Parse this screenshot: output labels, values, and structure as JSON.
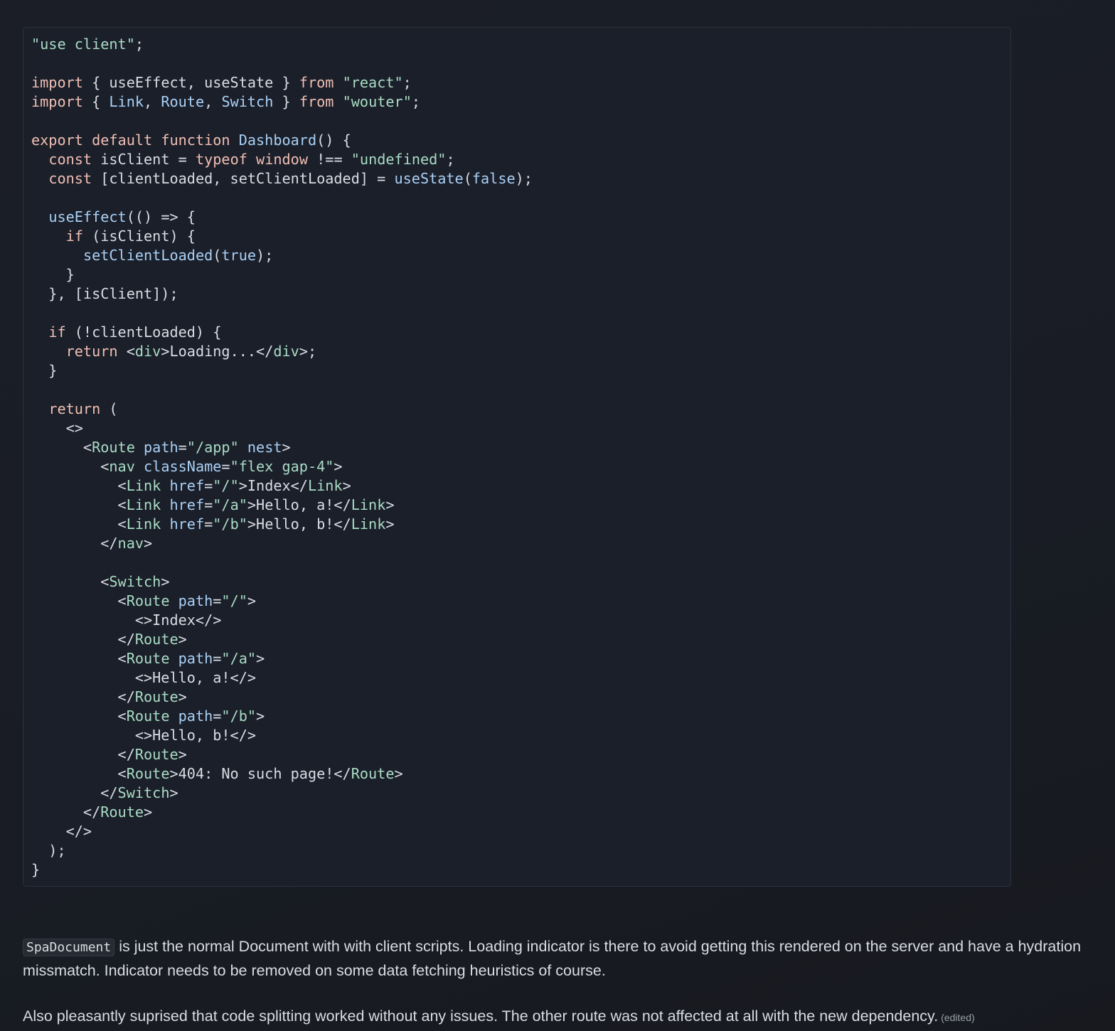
{
  "code_block": {
    "lines": [
      [
        {
          "t": "\"use client\"",
          "c": "string"
        },
        {
          "t": ";",
          "c": "punct"
        }
      ],
      [],
      [
        {
          "t": "import",
          "c": "keyword"
        },
        {
          "t": " { useEffect, useState } ",
          "c": "plain"
        },
        {
          "t": "from",
          "c": "keyword"
        },
        {
          "t": " ",
          "c": "plain"
        },
        {
          "t": "\"react\"",
          "c": "string"
        },
        {
          "t": ";",
          "c": "punct"
        }
      ],
      [
        {
          "t": "import",
          "c": "keyword"
        },
        {
          "t": " { ",
          "c": "plain"
        },
        {
          "t": "Link",
          "c": "func"
        },
        {
          "t": ", ",
          "c": "plain"
        },
        {
          "t": "Route",
          "c": "func"
        },
        {
          "t": ", ",
          "c": "plain"
        },
        {
          "t": "Switch",
          "c": "func"
        },
        {
          "t": " } ",
          "c": "plain"
        },
        {
          "t": "from",
          "c": "keyword"
        },
        {
          "t": " ",
          "c": "plain"
        },
        {
          "t": "\"wouter\"",
          "c": "string"
        },
        {
          "t": ";",
          "c": "punct"
        }
      ],
      [],
      [
        {
          "t": "export",
          "c": "keyword"
        },
        {
          "t": " ",
          "c": "plain"
        },
        {
          "t": "default",
          "c": "keyword"
        },
        {
          "t": " ",
          "c": "plain"
        },
        {
          "t": "function",
          "c": "keyword"
        },
        {
          "t": " ",
          "c": "plain"
        },
        {
          "t": "Dashboard",
          "c": "func"
        },
        {
          "t": "() {",
          "c": "plain"
        }
      ],
      [
        {
          "t": "  ",
          "c": "plain"
        },
        {
          "t": "const",
          "c": "keyword"
        },
        {
          "t": " isClient = ",
          "c": "plain"
        },
        {
          "t": "typeof",
          "c": "keyword"
        },
        {
          "t": " ",
          "c": "plain"
        },
        {
          "t": "window",
          "c": "keyword"
        },
        {
          "t": " !== ",
          "c": "plain"
        },
        {
          "t": "\"undefined\"",
          "c": "string"
        },
        {
          "t": ";",
          "c": "punct"
        }
      ],
      [
        {
          "t": "  ",
          "c": "plain"
        },
        {
          "t": "const",
          "c": "keyword"
        },
        {
          "t": " [clientLoaded, setClientLoaded] = ",
          "c": "plain"
        },
        {
          "t": "useState",
          "c": "func"
        },
        {
          "t": "(",
          "c": "plain"
        },
        {
          "t": "false",
          "c": "func"
        },
        {
          "t": ");",
          "c": "plain"
        }
      ],
      [],
      [
        {
          "t": "  ",
          "c": "plain"
        },
        {
          "t": "useEffect",
          "c": "func"
        },
        {
          "t": "(() => {",
          "c": "plain"
        }
      ],
      [
        {
          "t": "    ",
          "c": "plain"
        },
        {
          "t": "if",
          "c": "keyword"
        },
        {
          "t": " (isClient) {",
          "c": "plain"
        }
      ],
      [
        {
          "t": "      ",
          "c": "plain"
        },
        {
          "t": "setClientLoaded",
          "c": "func"
        },
        {
          "t": "(",
          "c": "plain"
        },
        {
          "t": "true",
          "c": "func"
        },
        {
          "t": ");",
          "c": "plain"
        }
      ],
      [
        {
          "t": "    }",
          "c": "plain"
        }
      ],
      [
        {
          "t": "  }, [isClient]);",
          "c": "plain"
        }
      ],
      [],
      [
        {
          "t": "  ",
          "c": "plain"
        },
        {
          "t": "if",
          "c": "keyword"
        },
        {
          "t": " (!clientLoaded) {",
          "c": "plain"
        }
      ],
      [
        {
          "t": "    ",
          "c": "plain"
        },
        {
          "t": "return",
          "c": "keyword"
        },
        {
          "t": " <",
          "c": "plain"
        },
        {
          "t": "div",
          "c": "tag"
        },
        {
          "t": ">Loading...</",
          "c": "plain"
        },
        {
          "t": "div",
          "c": "tag"
        },
        {
          "t": ">;",
          "c": "plain"
        }
      ],
      [
        {
          "t": "  }",
          "c": "plain"
        }
      ],
      [],
      [
        {
          "t": "  ",
          "c": "plain"
        },
        {
          "t": "return",
          "c": "keyword"
        },
        {
          "t": " (",
          "c": "plain"
        }
      ],
      [
        {
          "t": "    <>",
          "c": "plain"
        }
      ],
      [
        {
          "t": "      <",
          "c": "plain"
        },
        {
          "t": "Route",
          "c": "tag"
        },
        {
          "t": " ",
          "c": "plain"
        },
        {
          "t": "path",
          "c": "func"
        },
        {
          "t": "=",
          "c": "plain"
        },
        {
          "t": "\"/app\"",
          "c": "string"
        },
        {
          "t": " ",
          "c": "plain"
        },
        {
          "t": "nest",
          "c": "func"
        },
        {
          "t": ">",
          "c": "plain"
        }
      ],
      [
        {
          "t": "        <",
          "c": "plain"
        },
        {
          "t": "nav",
          "c": "tag"
        },
        {
          "t": " ",
          "c": "plain"
        },
        {
          "t": "className",
          "c": "func"
        },
        {
          "t": "=",
          "c": "plain"
        },
        {
          "t": "\"flex gap-4\"",
          "c": "string"
        },
        {
          "t": ">",
          "c": "plain"
        }
      ],
      [
        {
          "t": "          <",
          "c": "plain"
        },
        {
          "t": "Link",
          "c": "tag"
        },
        {
          "t": " ",
          "c": "plain"
        },
        {
          "t": "href",
          "c": "func"
        },
        {
          "t": "=",
          "c": "plain"
        },
        {
          "t": "\"/\"",
          "c": "string"
        },
        {
          "t": ">Index</",
          "c": "plain"
        },
        {
          "t": "Link",
          "c": "tag"
        },
        {
          "t": ">",
          "c": "plain"
        }
      ],
      [
        {
          "t": "          <",
          "c": "plain"
        },
        {
          "t": "Link",
          "c": "tag"
        },
        {
          "t": " ",
          "c": "plain"
        },
        {
          "t": "href",
          "c": "func"
        },
        {
          "t": "=",
          "c": "plain"
        },
        {
          "t": "\"/a\"",
          "c": "string"
        },
        {
          "t": ">Hello, a!</",
          "c": "plain"
        },
        {
          "t": "Link",
          "c": "tag"
        },
        {
          "t": ">",
          "c": "plain"
        }
      ],
      [
        {
          "t": "          <",
          "c": "plain"
        },
        {
          "t": "Link",
          "c": "tag"
        },
        {
          "t": " ",
          "c": "plain"
        },
        {
          "t": "href",
          "c": "func"
        },
        {
          "t": "=",
          "c": "plain"
        },
        {
          "t": "\"/b\"",
          "c": "string"
        },
        {
          "t": ">Hello, b!</",
          "c": "plain"
        },
        {
          "t": "Link",
          "c": "tag"
        },
        {
          "t": ">",
          "c": "plain"
        }
      ],
      [
        {
          "t": "        </",
          "c": "plain"
        },
        {
          "t": "nav",
          "c": "tag"
        },
        {
          "t": ">",
          "c": "plain"
        }
      ],
      [],
      [
        {
          "t": "        <",
          "c": "plain"
        },
        {
          "t": "Switch",
          "c": "tag"
        },
        {
          "t": ">",
          "c": "plain"
        }
      ],
      [
        {
          "t": "          <",
          "c": "plain"
        },
        {
          "t": "Route",
          "c": "tag"
        },
        {
          "t": " ",
          "c": "plain"
        },
        {
          "t": "path",
          "c": "func"
        },
        {
          "t": "=",
          "c": "plain"
        },
        {
          "t": "\"/\"",
          "c": "string"
        },
        {
          "t": ">",
          "c": "plain"
        }
      ],
      [
        {
          "t": "            <>Index</>",
          "c": "plain"
        }
      ],
      [
        {
          "t": "          </",
          "c": "plain"
        },
        {
          "t": "Route",
          "c": "tag"
        },
        {
          "t": ">",
          "c": "plain"
        }
      ],
      [
        {
          "t": "          <",
          "c": "plain"
        },
        {
          "t": "Route",
          "c": "tag"
        },
        {
          "t": " ",
          "c": "plain"
        },
        {
          "t": "path",
          "c": "func"
        },
        {
          "t": "=",
          "c": "plain"
        },
        {
          "t": "\"/a\"",
          "c": "string"
        },
        {
          "t": ">",
          "c": "plain"
        }
      ],
      [
        {
          "t": "            <>Hello, a!</>",
          "c": "plain"
        }
      ],
      [
        {
          "t": "          </",
          "c": "plain"
        },
        {
          "t": "Route",
          "c": "tag"
        },
        {
          "t": ">",
          "c": "plain"
        }
      ],
      [
        {
          "t": "          <",
          "c": "plain"
        },
        {
          "t": "Route",
          "c": "tag"
        },
        {
          "t": " ",
          "c": "plain"
        },
        {
          "t": "path",
          "c": "func"
        },
        {
          "t": "=",
          "c": "plain"
        },
        {
          "t": "\"/b\"",
          "c": "string"
        },
        {
          "t": ">",
          "c": "plain"
        }
      ],
      [
        {
          "t": "            <>Hello, b!</>",
          "c": "plain"
        }
      ],
      [
        {
          "t": "          </",
          "c": "plain"
        },
        {
          "t": "Route",
          "c": "tag"
        },
        {
          "t": ">",
          "c": "plain"
        }
      ],
      [
        {
          "t": "          <",
          "c": "plain"
        },
        {
          "t": "Route",
          "c": "tag"
        },
        {
          "t": ">404: No such page!</",
          "c": "plain"
        },
        {
          "t": "Route",
          "c": "tag"
        },
        {
          "t": ">",
          "c": "plain"
        }
      ],
      [
        {
          "t": "        </",
          "c": "plain"
        },
        {
          "t": "Switch",
          "c": "tag"
        },
        {
          "t": ">",
          "c": "plain"
        }
      ],
      [
        {
          "t": "      </",
          "c": "plain"
        },
        {
          "t": "Route",
          "c": "tag"
        },
        {
          "t": ">",
          "c": "plain"
        }
      ],
      [
        {
          "t": "    </>",
          "c": "plain"
        }
      ],
      [
        {
          "t": "  );",
          "c": "plain"
        }
      ],
      [
        {
          "t": "}",
          "c": "plain"
        }
      ]
    ]
  },
  "message": {
    "paragraph1_code": "SpaDocument",
    "paragraph1_text": " is just the normal Document with with client scripts. Loading indicator is there to avoid getting this rendered on the server and have a hydration missmatch. Indicator needs to be removed on some data fetching heuristics of course.",
    "paragraph2_text": "Also pleasantly suprised that code splitting worked without any issues. The other route was not affected at all with the new dependency.",
    "edited_label": "(edited)"
  },
  "colors": {
    "keyword": "#f0bfb3",
    "string": "#a9dcc4",
    "function": "#a9d0f5",
    "text": "#d8dce3",
    "background": "#1b1e27",
    "code_background": "#1b1f2a"
  }
}
